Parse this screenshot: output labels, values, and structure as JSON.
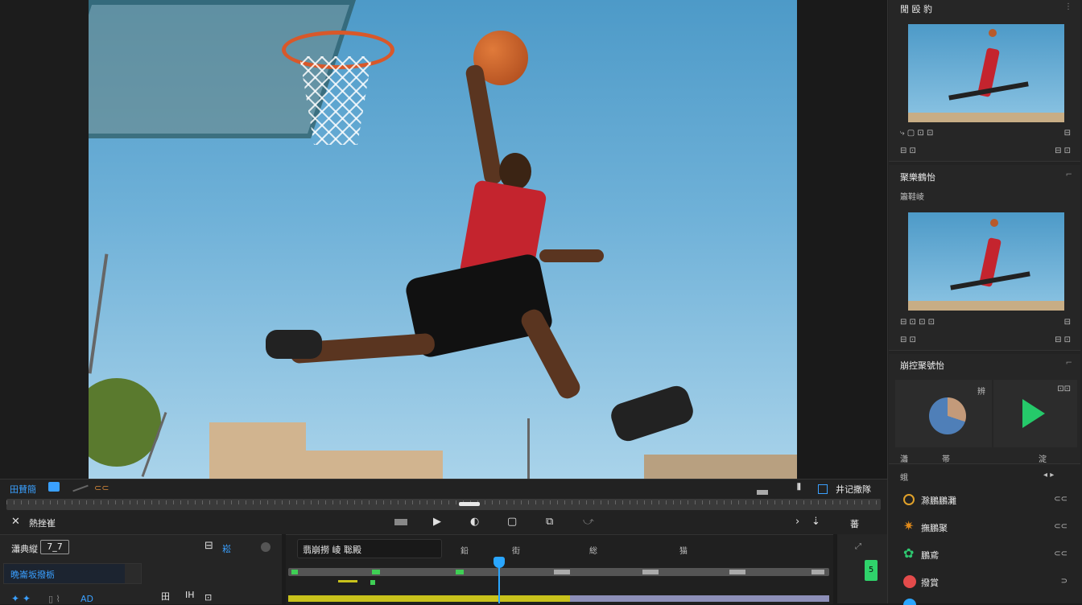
{
  "viewer": {
    "toolbar_left_label": "田賛簡",
    "toolbar_left_extra": "⊂⊂",
    "toolbar_right_label": "井记撒隊",
    "ctrl_left_label": "熱挫崔",
    "ctrl_right_label": "蕃"
  },
  "bottom_left": {
    "title": "瀟典縦",
    "title_value": "7_7",
    "tab_label": "崧",
    "search_text": "晩崙坂撥栃",
    "tool_labels": [
      "AD",
      "田",
      "IH",
      "⊡"
    ]
  },
  "timeline": {
    "label": "翡崩撈 崚 聡殿",
    "ruler": [
      "鉛",
      "街",
      "総",
      "猫"
    ],
    "track_indicator": "5"
  },
  "right_panel": {
    "top_card": {
      "title": "閒 殴 豹"
    },
    "effects_card": {
      "title": "聚樂鶴怡",
      "subtitle": "簫鞋崚"
    },
    "audio_card": {
      "title": "崩控聚號怡",
      "left_label": "辨",
      "right_label": "⊡⊡",
      "bottom_left": "瀟",
      "bottom_mid": "帯",
      "bottom_right": "淀"
    },
    "list_header": "蛾",
    "list_items": [
      {
        "label": "滁鵬鵬灘",
        "right": "⊂⊂",
        "color": "#e0a12a"
      },
      {
        "label": "撫鵬聚",
        "right": "⊂⊂",
        "color": "#e08a1a"
      },
      {
        "label": "鵬鳶",
        "right": "⊂⊂",
        "color": "#2ec870"
      },
      {
        "label": "撥賞",
        "right": "⊃",
        "color": "#e34b4b"
      }
    ]
  },
  "colors": {
    "accent_blue": "#2aa6ff",
    "play_green": "#25c96a",
    "track_yellow": "#c8c21b"
  }
}
